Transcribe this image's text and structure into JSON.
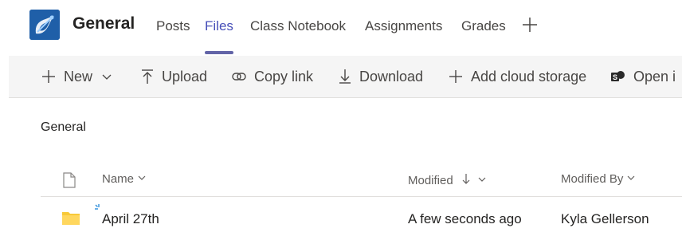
{
  "header": {
    "team_name": "General",
    "tabs": [
      {
        "label": "Posts"
      },
      {
        "label": "Files"
      },
      {
        "label": "Class Notebook"
      },
      {
        "label": "Assignments"
      },
      {
        "label": "Grades"
      }
    ],
    "active_tab": "Files"
  },
  "toolbar": {
    "new_label": "New",
    "upload_label": "Upload",
    "copy_link_label": "Copy link",
    "download_label": "Download",
    "add_cloud_label": "Add cloud storage",
    "open_label": "Open i"
  },
  "breadcrumb": "General",
  "table": {
    "columns": {
      "name": "Name",
      "modified": "Modified",
      "modified_by": "Modified By"
    },
    "rows": [
      {
        "name": "April 27th",
        "modified": "A few seconds ago",
        "modified_by": "Kyla Gellerson",
        "icon": "folder-icon"
      }
    ]
  },
  "colors": {
    "accent": "#6264a7",
    "active_tab_text": "#464eb8",
    "folder": "#f8c938",
    "team_logo_bg": "#1f5fa8",
    "sharepoint": "#2a2a2a"
  }
}
